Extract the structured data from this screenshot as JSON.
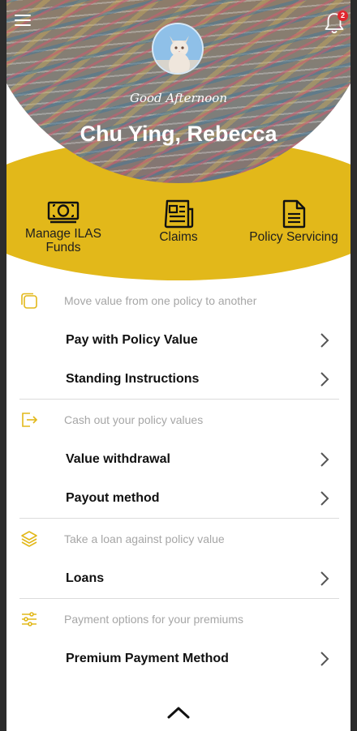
{
  "colors": {
    "accent": "#e2b81a",
    "badge": "#e0262e",
    "section_title": "#a6a6a6"
  },
  "header": {
    "menu_icon": "hamburger-menu-icon",
    "notification_icon": "bell-icon",
    "notification_count": "2",
    "greeting": "Good Afternoon",
    "user_name": "Chu Ying, Rebecca"
  },
  "quick_actions": [
    {
      "label": "Manage ILAS Funds",
      "icon": "cash-icon"
    },
    {
      "label": "Claims",
      "icon": "newspaper-icon"
    },
    {
      "label": "Policy Servicing",
      "icon": "document-icon"
    }
  ],
  "sections": [
    {
      "title": "Move value from one policy to another",
      "icon": "copy-icon",
      "items": [
        "Pay with Policy Value",
        "Standing Instructions"
      ]
    },
    {
      "title": "Cash out your policy values",
      "icon": "sign-out-icon",
      "items": [
        "Value withdrawal",
        "Payout method"
      ]
    },
    {
      "title": "Take a loan against policy value",
      "icon": "layers-icon",
      "items": [
        "Loans"
      ]
    },
    {
      "title": "Payment options for your premiums",
      "icon": "sliders-icon",
      "items": [
        "Premium Payment Method"
      ]
    }
  ],
  "footer": {
    "collapse_icon": "chevron-up-icon"
  }
}
